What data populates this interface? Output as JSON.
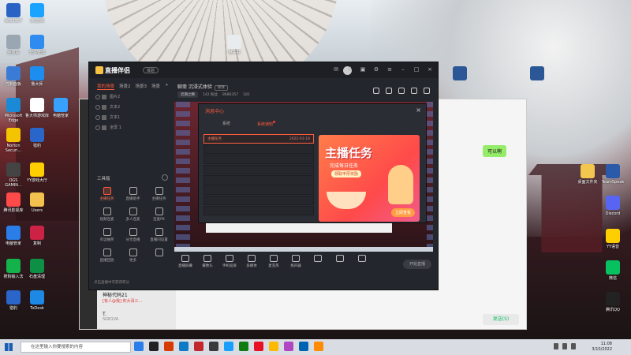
{
  "desktop": {
    "icons_left": [
      {
        "label": "8686357",
        "color": "#2b63c4"
      },
      {
        "label": "QQ游戏",
        "color": "#1aa3ff"
      },
      {
        "label": "回收站",
        "color": "#9aa6b2"
      },
      {
        "label": "软件管理",
        "color": "#2f8bf0"
      },
      {
        "label": "控制面板",
        "color": "#3a7bd5"
      },
      {
        "label": "鲁大师",
        "color": "#1d8ef0"
      },
      {
        "label": "Microsoft Edge",
        "color": "#1b8ad6"
      },
      {
        "label": "鲁大师游戏库",
        "color": "#ffffff"
      },
      {
        "label": "电脑管家",
        "color": "#38a1ff"
      },
      {
        "label": "Norton Securi...",
        "color": "#f5c400"
      },
      {
        "label": "猎豹",
        "color": "#2a66c9"
      },
      {
        "label": "OGS GAMIN...",
        "color": "#444444"
      },
      {
        "label": "YY游戏大厅",
        "color": "#ffce00"
      },
      {
        "label": "腾讯影视库",
        "color": "#ff4a4a"
      },
      {
        "label": "Users",
        "color": "#f2c14e"
      },
      {
        "label": "电脑管家",
        "color": "#2b7de9"
      },
      {
        "label": "复制",
        "color": "#cc2244"
      },
      {
        "label": "搜狗输入法",
        "color": "#14b24a"
      },
      {
        "label": "石盘清理",
        "color": "#0d8f45"
      },
      {
        "label": "猎豹",
        "color": "#2a66c9"
      },
      {
        "label": "ToDesk",
        "color": "#1e88e5"
      }
    ],
    "icons_top": [
      {
        "label": "电子书",
        "color": "#e8ecef"
      }
    ],
    "icons_right": [
      {
        "label": "",
        "color": "#2b5797"
      },
      {
        "label": "",
        "color": "#2b5797"
      },
      {
        "label": "桌面文件夹",
        "color": "#f3c74f"
      },
      {
        "label": "TeamSpeak",
        "color": "#2a5aa8"
      },
      {
        "label": "Discord",
        "color": "#5865f2"
      },
      {
        "label": "YY语音",
        "color": "#ffce00"
      },
      {
        "label": "微信",
        "color": "#07c160"
      },
      {
        "label": "腾讯QQ",
        "color": "#222222"
      }
    ]
  },
  "chat": {
    "items": [
      {
        "name": "神秘代码21",
        "preview": "[有人@我] 你大哥三...",
        "time": ""
      },
      {
        "name": "T.",
        "preview": "SGB1VA",
        "time": "3/24"
      }
    ],
    "bubble": "可以啊",
    "send_label": "发送(S)"
  },
  "app": {
    "name": "直播伴侣",
    "version": "体验",
    "scene_tabs": [
      "我的场景",
      "场景2",
      "场景3",
      "场景"
    ],
    "sources": [
      "图片2",
      "文本2",
      "文本1",
      "全屏 1"
    ],
    "tools_title": "工具箱",
    "tools": [
      {
        "label": "主播任务",
        "hot": true
      },
      {
        "label": "直播助手",
        "hot": false
      },
      {
        "label": "主播任务",
        "hot": false
      },
      {
        "label": "视频连麦",
        "hot": false
      },
      {
        "label": "多人连麦",
        "hot": false
      },
      {
        "label": "连麦PK",
        "hot": false
      },
      {
        "label": "幸运抽奖",
        "hot": false
      },
      {
        "label": "分享直播",
        "hot": false
      },
      {
        "label": "直播间设置",
        "hot": false
      },
      {
        "label": "直播回放",
        "hot": false
      },
      {
        "label": "更多",
        "hot": false
      },
      {
        "label": "",
        "hot": false
      }
    ],
    "tools_hint": "点击直播中可获得积分",
    "live_title": "聊斋 沉浸式体验",
    "live_badge": "修改",
    "live_category": "近期之精",
    "live_fans": "142 粉丝",
    "live_id": "8686357",
    "live_likes": "181",
    "controls": [
      "直播屏幕",
      "摄像头",
      "手机投屏",
      "多媒体",
      "麦克风",
      "扬声器",
      "",
      "",
      ""
    ],
    "start_label": "开始直播"
  },
  "message_center": {
    "title": "消息中心",
    "tabs": [
      {
        "label": "系统",
        "on": false
      },
      {
        "label": "系统通知",
        "on": true
      }
    ],
    "rows": [
      {
        "label": "主播任务",
        "date": "2022-03-18",
        "selected": true
      },
      {
        "label": "",
        "date": "",
        "selected": false
      },
      {
        "label": "",
        "date": "",
        "selected": false
      },
      {
        "label": "",
        "date": "",
        "selected": false
      },
      {
        "label": "",
        "date": "",
        "selected": false
      },
      {
        "label": "",
        "date": "",
        "selected": false
      },
      {
        "label": "",
        "date": "",
        "selected": false
      },
      {
        "label": "",
        "date": "",
        "selected": false
      }
    ],
    "banner": {
      "headline": "主播任务",
      "sub": "完成每日任务",
      "pill": "领取丰厚奖励",
      "button": "立即查看"
    }
  },
  "taskbar": {
    "search_placeholder": "在这里输入你要搜索的内容",
    "time": "11:08",
    "date": "3/10/2022",
    "apps": [
      "#2b7de9",
      "#222222",
      "#d83b01",
      "#0f7ac6",
      "#c1272d",
      "#3a3a3a",
      "#1a9fff",
      "#107c10",
      "#e81123",
      "#ffb900",
      "#b146c2",
      "#0063b1",
      "#ff8c00"
    ]
  }
}
